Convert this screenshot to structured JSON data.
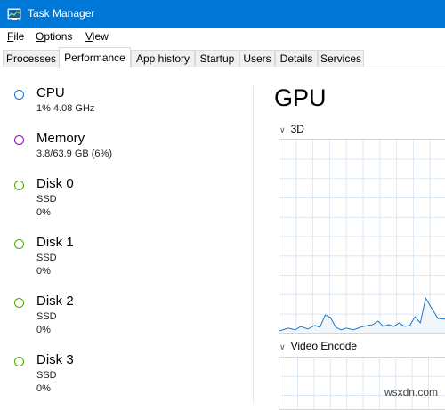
{
  "window": {
    "title": "Task Manager",
    "icon": "task-manager-icon"
  },
  "menu": [
    {
      "label": "File",
      "underline": "F",
      "rest": "ile"
    },
    {
      "label": "Options",
      "underline": "O",
      "rest": "ptions"
    },
    {
      "label": "View",
      "underline": "V",
      "rest": "iew"
    }
  ],
  "tabs": [
    {
      "label": "Processes",
      "active": false
    },
    {
      "label": "Performance",
      "active": true
    },
    {
      "label": "App history",
      "active": false
    },
    {
      "label": "Startup",
      "active": false
    },
    {
      "label": "Users",
      "active": false
    },
    {
      "label": "Details",
      "active": false
    },
    {
      "label": "Services",
      "active": false
    }
  ],
  "sidebar": {
    "items": [
      {
        "name": "CPU",
        "line1": "1%  4.08 GHz",
        "color": "#1a74c4"
      },
      {
        "name": "Memory",
        "line1": "3.8/63.9 GB (6%)",
        "color": "#8b12ae"
      },
      {
        "name": "Disk 0",
        "line1": "SSD",
        "line2": "0%",
        "color": "#4da60c"
      },
      {
        "name": "Disk 1",
        "line1": "SSD",
        "line2": "0%",
        "color": "#4da60c"
      },
      {
        "name": "Disk 2",
        "line1": "SSD",
        "line2": "0%",
        "color": "#4da60c"
      },
      {
        "name": "Disk 3",
        "line1": "SSD",
        "line2": "0%",
        "color": "#4da60c"
      }
    ]
  },
  "main": {
    "title": "GPU",
    "engines": [
      {
        "label": "3D",
        "line_color": "#1a74c4",
        "grid_color": "#dce8f4"
      },
      {
        "label": "Video Encode",
        "line_color": "#1a74c4",
        "grid_color": "#dce8f4"
      }
    ]
  },
  "watermark": "wsxdn.com"
}
